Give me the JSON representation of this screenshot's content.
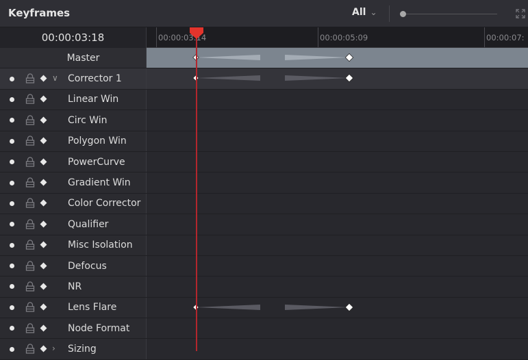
{
  "header": {
    "title": "Keyframes",
    "filter_label": "All",
    "zoom_level": 0.0
  },
  "timeline": {
    "current_timecode": "00:00:03:18",
    "ruler_labels": [
      "00:00:03:14",
      "00:00:05:09",
      "00:00:07:"
    ]
  },
  "rows": [
    {
      "label": "Master",
      "kind": "master",
      "keyframes": [
        "00:00:03:18",
        "00:00:05:18"
      ]
    },
    {
      "label": "Corrector 1",
      "kind": "corrector",
      "keyframes": [
        "00:00:03:18",
        "00:00:05:18"
      ]
    },
    {
      "label": "Linear Win",
      "kind": "node",
      "keyframes": []
    },
    {
      "label": "Circ Win",
      "kind": "node",
      "keyframes": []
    },
    {
      "label": "Polygon Win",
      "kind": "node",
      "keyframes": []
    },
    {
      "label": "PowerCurve",
      "kind": "node",
      "keyframes": []
    },
    {
      "label": "Gradient Win",
      "kind": "node",
      "keyframes": []
    },
    {
      "label": "Color Corrector",
      "kind": "node",
      "keyframes": []
    },
    {
      "label": "Qualifier",
      "kind": "node",
      "keyframes": []
    },
    {
      "label": "Misc Isolation",
      "kind": "node",
      "keyframes": []
    },
    {
      "label": "Defocus",
      "kind": "node",
      "keyframes": []
    },
    {
      "label": "NR",
      "kind": "node",
      "keyframes": []
    },
    {
      "label": "Lens Flare",
      "kind": "node",
      "keyframes": [
        "00:00:03:18",
        "00:00:05:18"
      ]
    },
    {
      "label": "Node Format",
      "kind": "node",
      "keyframes": []
    },
    {
      "label": "Sizing",
      "kind": "sizing",
      "keyframes": []
    }
  ],
  "colors": {
    "playhead": "#b3262d",
    "master_track": "#7c858f",
    "panel_bg": "#28282e"
  }
}
